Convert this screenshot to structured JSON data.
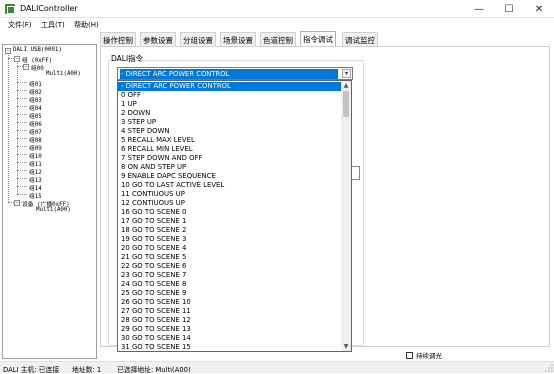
{
  "window": {
    "title": "DALIController",
    "minimize": "—",
    "maximize": "☐",
    "close": "✕"
  },
  "menu": [
    "文件(F)",
    "工具(T)",
    "帮助(H)"
  ],
  "tree": {
    "root": "DALI USB(0001)",
    "group_parent": "组 (0xFF)",
    "group0": "组00",
    "multi0": "Multi(A00)",
    "groups": [
      "组01",
      "组02",
      "组03",
      "组04",
      "组05",
      "组06",
      "组07",
      "组08",
      "组09",
      "组10",
      "组11",
      "组12",
      "组13",
      "组14",
      "组15"
    ],
    "device_parent": "设备 (广播0xFF)",
    "device_multi": "Multi(A00)"
  },
  "tabs": [
    "操作控制",
    "参数设置",
    "分组设置",
    "场景设置",
    "色道控制",
    "指令调试",
    "调试监控"
  ],
  "active_tab": 5,
  "panel": {
    "group_label": "DALI指令",
    "combo_value": "- DIRECT ARC POWER CONTROL"
  },
  "dropdown_items": [
    "- DIRECT ARC POWER CONTROL",
    "0  OFF",
    "1  UP",
    "2  DOWN",
    "3  STEP UP",
    "4  STEP DOWN",
    "5  RECALL MAX LEVEL",
    "6  RECALL MIN LEVEL",
    "7  STEP DOWN AND OFF",
    "8  ON AND STEP UP",
    "9  ENABLE DAPC SEQUENCE",
    "10  GO TO LAST ACTIVE LEVEL",
    "11  CONTIUOUS UP",
    "12  CONTIUOUS UP",
    "16  GO TO SCENE  0",
    "17  GO TO SCENE  1",
    "18  GO TO SCENE  2",
    "19  GO TO SCENE  3",
    "20  GO TO SCENE  4",
    "21  GO TO SCENE  5",
    "22  GO TO SCENE  6",
    "23  GO TO SCENE  7",
    "24  GO TO SCENE  8",
    "25  GO TO SCENE  9",
    "26  GO TO SCENE  10",
    "27  GO TO SCENE  11",
    "28  GO TO SCENE  12",
    "29  GO TO SCENE  13",
    "30  GO TO SCENE  14",
    "31  GO TO SCENE  15"
  ],
  "selected_index": 0,
  "checkbox_label": "持续调光",
  "status": {
    "host": "DALI 主机: 已连接",
    "addr_count": "地址数: 1",
    "selected_addr": "已选择地址: Multi(A00)"
  },
  "colors": {
    "selection": "#0078d7",
    "app_icon": "#3a8a3a"
  }
}
